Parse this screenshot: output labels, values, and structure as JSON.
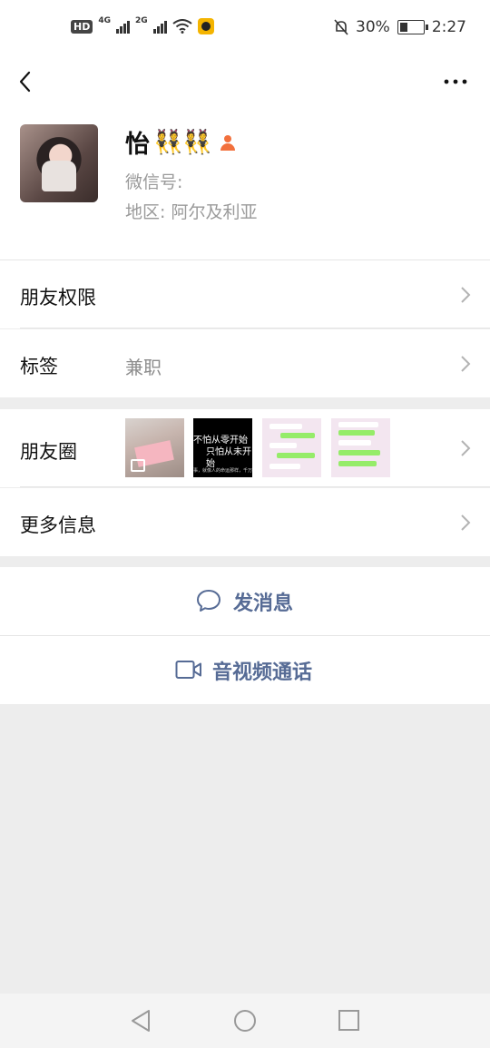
{
  "status_bar": {
    "hd": "HD",
    "net1": "4G",
    "net2": "2G",
    "battery_percent": "30%",
    "time": "2:27"
  },
  "profile": {
    "name": "怡",
    "name_emoji": "👯👯",
    "wechat_id_label": "微信号: ",
    "wechat_id_value": "",
    "region_label": "地区: ",
    "region_value": "阿尔及利亚"
  },
  "rows": {
    "permissions": "朋友权限",
    "tags_label": "标签",
    "tags_value": "兼职",
    "moments": "朋友圈",
    "more_info": "更多信息"
  },
  "moments_thumbs": {
    "t2_line1": "不怕从零开始",
    "t2_line2": "只怕从未开始",
    "t2_line3": "事，就像人的命运那样，千万不要"
  },
  "actions": {
    "message": "发消息",
    "call": "音视频通话"
  },
  "colors": {
    "accent": "#566b95",
    "background": "#ededed"
  }
}
